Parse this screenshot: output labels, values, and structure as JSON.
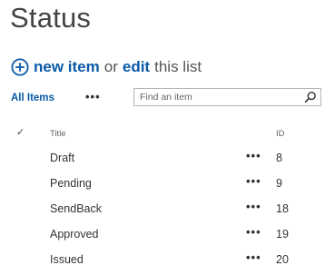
{
  "page": {
    "title": "Status"
  },
  "actions": {
    "new_item_label": "new item",
    "or_text": "or",
    "edit_label": "edit",
    "this_list_text": "this list"
  },
  "views": {
    "all_items_label": "All Items",
    "more_label": "•••"
  },
  "search": {
    "placeholder": "Find an item"
  },
  "table": {
    "check_glyph": "✓",
    "columns": {
      "title": "Title",
      "id": "ID"
    },
    "row_menu_label": "•••",
    "rows": [
      {
        "title": "Draft",
        "id": "8"
      },
      {
        "title": "Pending",
        "id": "9"
      },
      {
        "title": "SendBack",
        "id": "18"
      },
      {
        "title": "Approved",
        "id": "19"
      },
      {
        "title": "Issued",
        "id": "20"
      }
    ]
  },
  "colors": {
    "link": "#0a5aa8",
    "text": "#333333",
    "muted": "#666666",
    "border": "#b5b5b5"
  },
  "icons": {
    "new_item": "plus-circle-icon",
    "search": "search-icon",
    "select_all": "check-icon"
  }
}
